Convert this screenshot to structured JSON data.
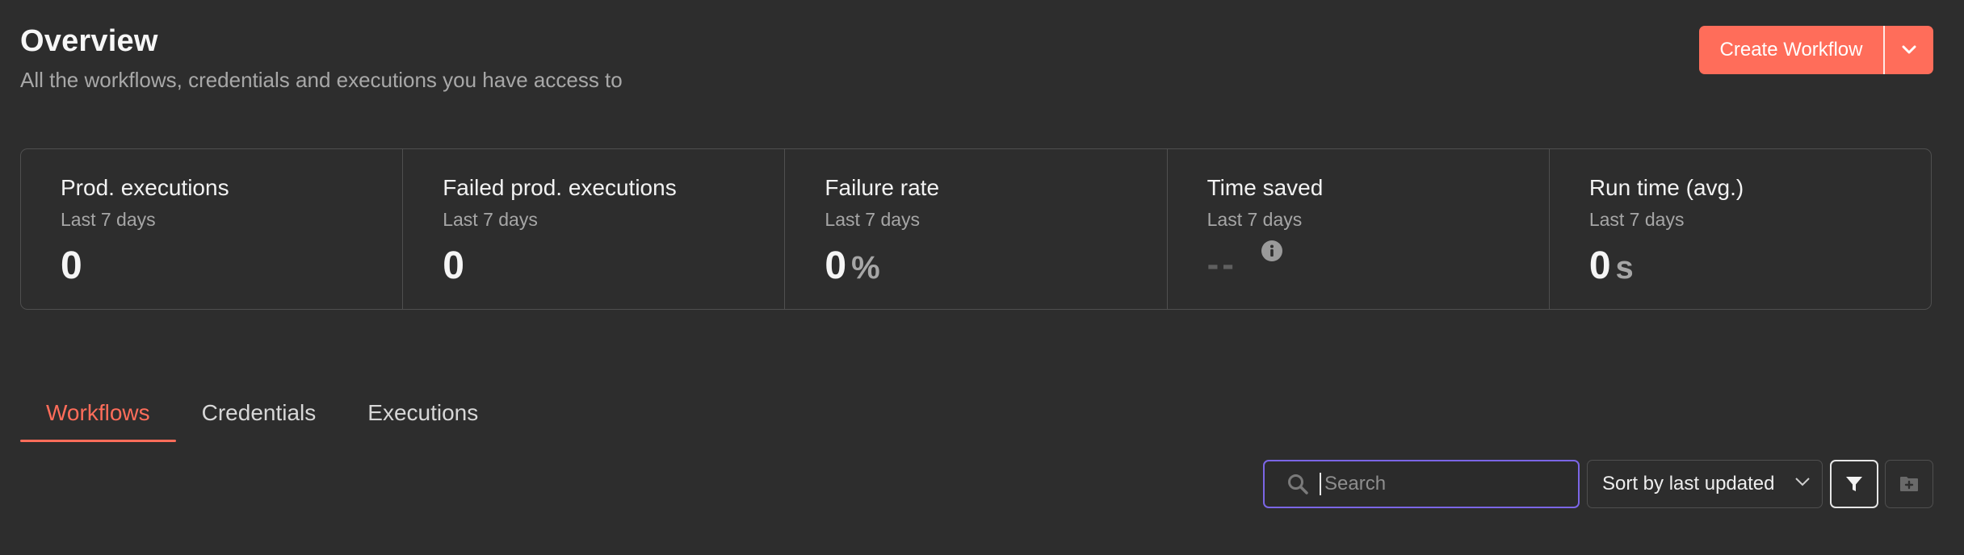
{
  "header": {
    "title": "Overview",
    "subtitle": "All the workflows, credentials and executions you have access to",
    "create_button_label": "Create Workflow",
    "dropdown_icon": "chevron-down-icon"
  },
  "stats": [
    {
      "label": "Prod. executions",
      "period": "Last 7 days",
      "value": "0",
      "unit": ""
    },
    {
      "label": "Failed prod. executions",
      "period": "Last 7 days",
      "value": "0",
      "unit": ""
    },
    {
      "label": "Failure rate",
      "period": "Last 7 days",
      "value": "0",
      "unit": "%"
    },
    {
      "label": "Time saved",
      "period": "Last 7 days",
      "value": "--",
      "unit": "",
      "info_icon": "info-icon"
    },
    {
      "label": "Run time (avg.)",
      "period": "Last 7 days",
      "value": "0",
      "unit": "s"
    }
  ],
  "tabs": [
    {
      "label": "Workflows",
      "active": true
    },
    {
      "label": "Credentials",
      "active": false
    },
    {
      "label": "Executions",
      "active": false
    }
  ],
  "toolbar": {
    "search_placeholder": "Search",
    "search_value": "",
    "sort_label": "Sort by last updated",
    "filter_icon": "filter-icon",
    "folder_icon": "add-folder-icon"
  },
  "colors": {
    "background": "#2d2d2d",
    "accent": "#ff6d5a",
    "focus_border": "#7b66e6",
    "border": "#4f4f4f",
    "muted_text": "#a6a6a6"
  }
}
